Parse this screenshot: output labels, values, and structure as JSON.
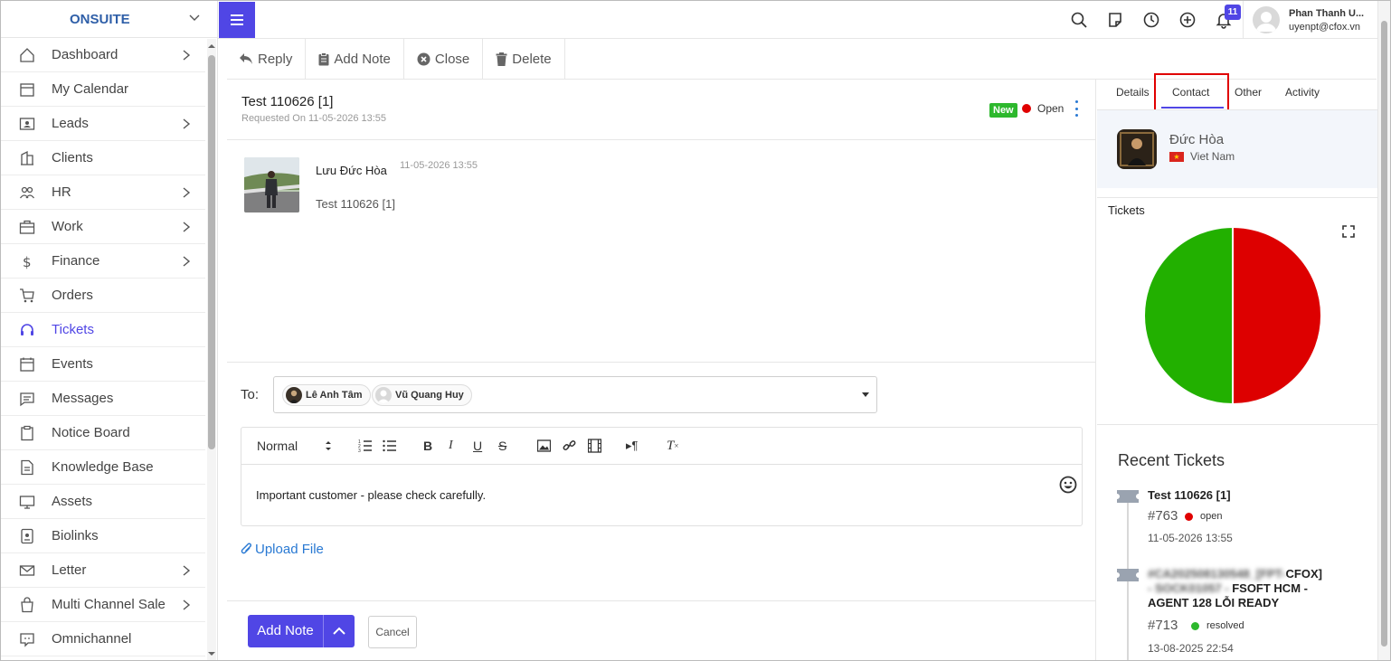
{
  "brand": "ONSUITE",
  "sidebar": {
    "items": [
      {
        "label": "Dashboard",
        "icon": "home-icon",
        "arrow": true
      },
      {
        "label": "My Calendar",
        "icon": "calendar-icon",
        "arrow": false
      },
      {
        "label": "Leads",
        "icon": "contact-card-icon",
        "arrow": true
      },
      {
        "label": "Clients",
        "icon": "building-icon",
        "arrow": false
      },
      {
        "label": "HR",
        "icon": "people-icon",
        "arrow": true
      },
      {
        "label": "Work",
        "icon": "briefcase-icon",
        "arrow": true
      },
      {
        "label": "Finance",
        "icon": "dollar-icon",
        "arrow": true
      },
      {
        "label": "Orders",
        "icon": "cart-icon",
        "arrow": false
      },
      {
        "label": "Tickets",
        "icon": "headset-icon",
        "arrow": false,
        "active": true
      },
      {
        "label": "Events",
        "icon": "calendar-event-icon",
        "arrow": false
      },
      {
        "label": "Messages",
        "icon": "message-icon",
        "arrow": false
      },
      {
        "label": "Notice Board",
        "icon": "clipboard-icon",
        "arrow": false
      },
      {
        "label": "Knowledge Base",
        "icon": "document-icon",
        "arrow": false
      },
      {
        "label": "Assets",
        "icon": "monitor-icon",
        "arrow": false
      },
      {
        "label": "Biolinks",
        "icon": "id-badge-icon",
        "arrow": false
      },
      {
        "label": "Letter",
        "icon": "envelope-icon",
        "arrow": true
      },
      {
        "label": "Multi Channel Sale",
        "icon": "shopping-bag-icon",
        "arrow": true
      },
      {
        "label": "Omnichannel",
        "icon": "chat-icon",
        "arrow": false
      }
    ]
  },
  "topbar": {
    "notification_count": "11",
    "user_name": "Phan Thanh U...",
    "user_email": "uyenpt@cfox.vn"
  },
  "actions": {
    "reply": "Reply",
    "add_note": "Add Note",
    "close": "Close",
    "delete": "Delete"
  },
  "ticket": {
    "title": "Test 110626 [1]",
    "requested": "Requested On 11-05-2026 13:55",
    "badge": "New",
    "status": "Open",
    "message": {
      "author": "Lưu Đức Hòa",
      "date": "11-05-2026 13:55",
      "body": "Test 110626 [1]"
    }
  },
  "reply": {
    "to_label": "To:",
    "recipients": [
      "Lê Anh Tâm",
      "Vũ Quang Huy"
    ],
    "format": "Normal",
    "note_text": "Important customer - please check carefully.",
    "upload_label": "Upload File",
    "submit_label": "Add Note",
    "cancel_label": "Cancel"
  },
  "right_panel": {
    "tabs": [
      "Details",
      "Contact",
      "Other",
      "Activity"
    ],
    "active_tab": "Contact",
    "contact": {
      "name": "Đức Hòa",
      "country": "Viet Nam"
    },
    "tickets_title": "Tickets",
    "recent_title": "Recent Tickets",
    "recent": [
      {
        "title": "Test 110626 [1]",
        "number": "#763",
        "status": "open",
        "status_color": "#e00000",
        "date": "11-05-2026 13:55",
        "blurred": false
      },
      {
        "title_blurred": "#CA2025081305​48_[FPT-",
        "title_visible_1": "CFOX]",
        "title_line2_blurred": "- SOCK01057 - ",
        "title_line2_visible": "FSOFT HCM -",
        "title_line3": "AGENT 128 LỖI READY",
        "number": "#713",
        "status": "resolved",
        "status_color": "#2db82d",
        "date": "13-08-2025 22:54"
      }
    ]
  },
  "chart_data": {
    "type": "pie",
    "title": "Tickets",
    "slices": [
      {
        "label": "open",
        "value": 50,
        "color": "#dd0000"
      },
      {
        "label": "resolved",
        "value": 50,
        "color": "#22b000"
      }
    ]
  },
  "colors": {
    "accent": "#5046e5",
    "link": "#2979d3",
    "open": "#e00000",
    "resolved": "#2db82d"
  }
}
